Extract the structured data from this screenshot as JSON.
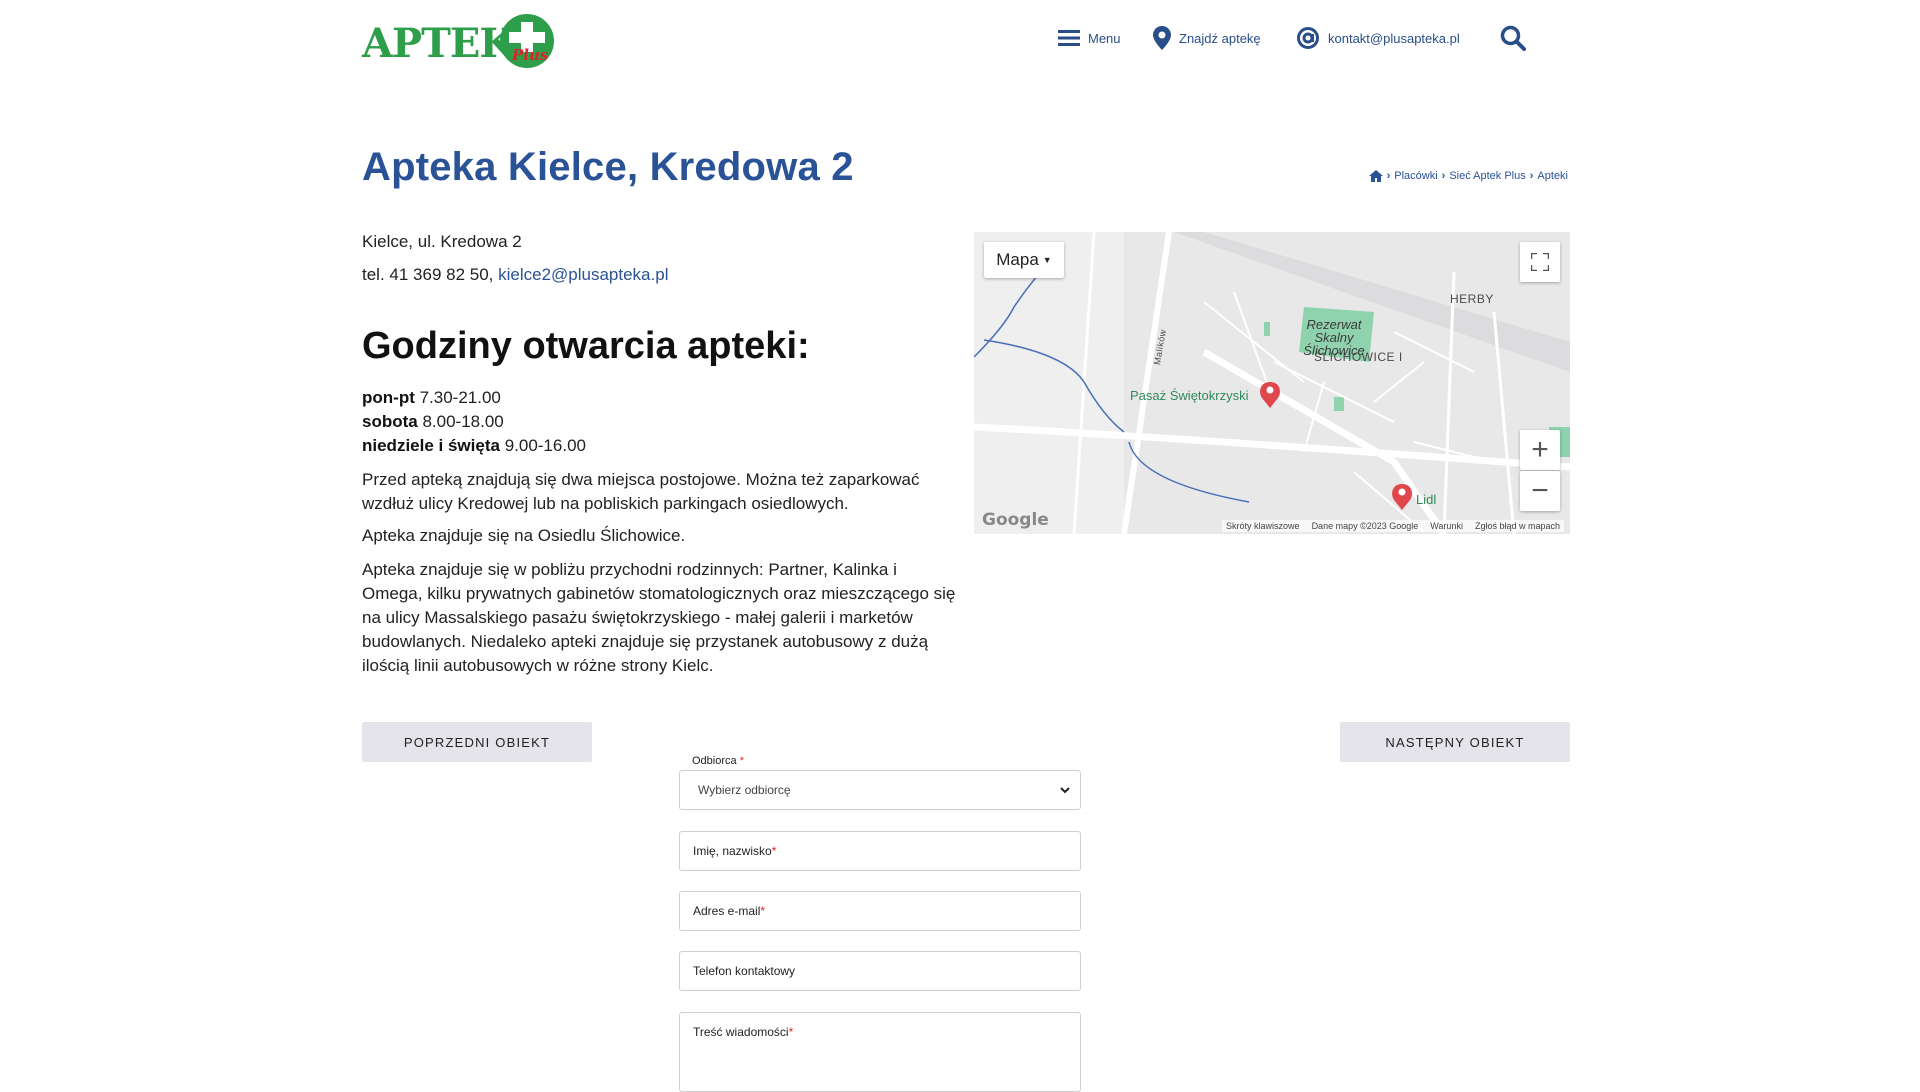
{
  "header": {
    "logo_text": "APTEKA",
    "logo_plus": "Plus",
    "nav": {
      "menu": "Menu",
      "find": "Znajdź aptekę",
      "contact": "kontakt@plusapteka.pl"
    }
  },
  "page": {
    "title": "Apteka Kielce, Kredowa 2",
    "breadcrumb": [
      "Placówki",
      "Sieć Aptek Plus",
      "Apteki"
    ]
  },
  "info": {
    "address": "Kielce, ul. Kredowa 2",
    "phone_prefix": "tel. 41 369 82 50, ",
    "email": "kielce2@plusapteka.pl",
    "hours_title": "Godziny otwarcia apteki:",
    "hours": [
      {
        "day": "pon-pt",
        "time": "7.30-21.00"
      },
      {
        "day": "sobota",
        "time": "8.00-18.00"
      },
      {
        "day": "niedziele i święta",
        "time": "9.00-16.00"
      }
    ],
    "paragraphs": [
      "Przed apteką znajdują się dwa miejsca postojowe. Można też zaparkować wzdłuż ulicy Kredowej lub na pobliskich parkingach osiedlowych.",
      "Apteka znajduje się na Osiedlu Ślichowice.",
      "Apteka znajduje się w pobliżu przychodni rodzinnych: Partner, Kalinka i Omega, kilku prywatnych gabinetów stomatologicznych oraz mieszczącego się na ulicy Massalskiego pasażu świętokrzyskiego - małej galerii i marketów budowlanych. Niedaleko apteki znajduje się przystanek autobusowy z dużą ilością linii autobusowych w różne strony Kielc."
    ]
  },
  "map": {
    "type_label": "Mapa",
    "labels": {
      "herby": "HERBY",
      "slichowice": "ŚLICHOWICE I",
      "rezerwat": "Rezerwat Skalny Ślichowice",
      "pasaz": "Pasaż Świętokrzyski",
      "lidl": "Lidl",
      "street": "Malików"
    },
    "google": "Google",
    "footer": [
      "Skróty klawiszowe",
      "Dane mapy ©2023 Google",
      "Warunki",
      "Zgłoś błąd w mapach"
    ]
  },
  "buttons": {
    "prev": "POPRZEDNI OBIEKT",
    "next": "NASTĘPNY OBIEKT"
  },
  "form": {
    "recipient_label": "Odbiorca",
    "recipient_value": "Wybierz odbiorcę",
    "name_ph": "Imię, nazwisko",
    "email_ph": "Adres e-mail",
    "phone_ph": "Telefon kontaktowy",
    "message_ph": "Treść wiadomości",
    "required_mark": "*"
  },
  "colors": {
    "brand_green": "#2e9e4a",
    "brand_blue": "#2a5296",
    "accent_red": "#d7262c"
  }
}
